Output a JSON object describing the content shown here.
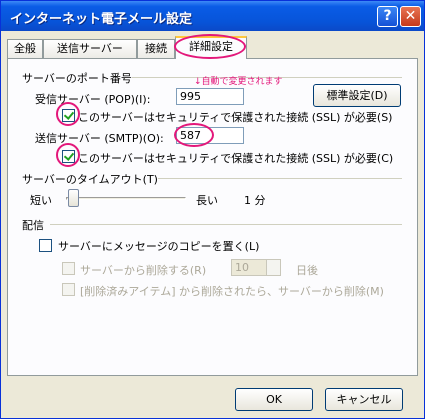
{
  "window": {
    "title": "インターネット電子メール設定",
    "help_label": "?",
    "close_label": "✕"
  },
  "tabs": [
    {
      "label": "全般"
    },
    {
      "label": "送信サーバー"
    },
    {
      "label": "接続"
    },
    {
      "label": "詳細設定"
    }
  ],
  "ports": {
    "section_title": "サーバーのポート番号",
    "note": "↓自動で変更されます",
    "incoming_label": "受信サーバー (POP)(I):",
    "incoming_value": "995",
    "default_button": "標準設定(D)",
    "ssl_incoming": {
      "label": "このサーバーはセキュリティで保護された接続 (SSL) が必要(S)",
      "checked": true
    },
    "outgoing_label": "送信サーバー (SMTP)(O):",
    "outgoing_value": "587",
    "ssl_outgoing": {
      "label": "このサーバーはセキュリティで保護された接続 (SSL) が必要(C)",
      "checked": true
    }
  },
  "timeout": {
    "section_title": "サーバーのタイムアウト(T)",
    "short_label": "短い",
    "long_label": "長い",
    "value_label": "1 分",
    "level": 0.0
  },
  "delivery": {
    "section_title": "配信",
    "leave_copy": {
      "label": "サーバーにメッセージのコピーを置く(L)",
      "checked": false
    },
    "remove_after": {
      "label": "サーバーから削除する(R)",
      "checked": false,
      "days_value": "10",
      "days_unit": "日後"
    },
    "remove_deleted": {
      "label": "[削除済みアイテム] から削除されたら、サーバーから削除(M)",
      "checked": false
    }
  },
  "footer": {
    "ok_label": "OK",
    "cancel_label": "キャンセル"
  },
  "colors": {
    "highlight": "#e3177a",
    "titlebar": "#0a5ce6"
  },
  "icons": {
    "help": "help-icon",
    "close": "close-icon"
  }
}
